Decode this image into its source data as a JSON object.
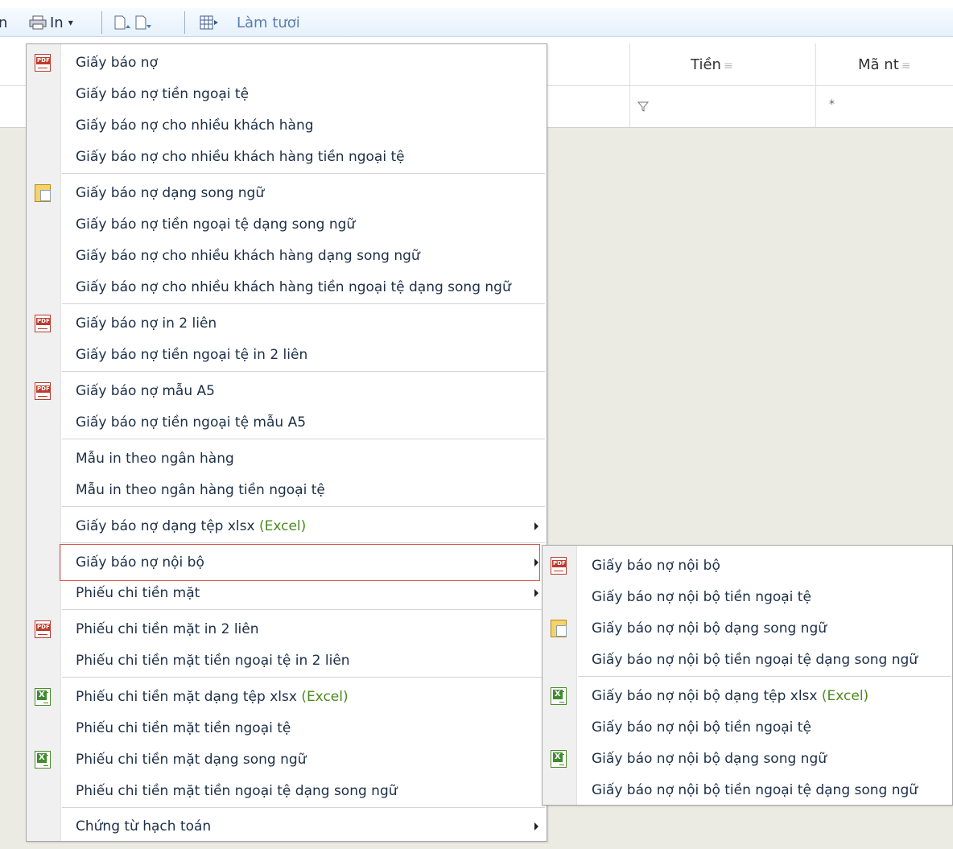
{
  "toolbar": {
    "print_label": "In",
    "refresh_label": "Làm tươi"
  },
  "grid": {
    "columns": [
      "Tiền",
      "Mã nt"
    ],
    "filter_star": "*"
  },
  "menu": {
    "items": [
      {
        "label": "Giấy báo nợ",
        "icon": "pdf"
      },
      {
        "label": "Giấy báo nợ tiền ngoại tệ"
      },
      {
        "label": "Giấy báo nợ cho nhiều khách hàng"
      },
      {
        "label": "Giấy báo nợ cho nhiều khách hàng tiền ngoại tệ"
      },
      {
        "label": "Giấy báo nợ dạng song ngữ",
        "icon": "bilingual"
      },
      {
        "label": "Giấy báo nợ tiền ngoại tệ dạng song ngữ"
      },
      {
        "label": "Giấy báo nợ cho nhiều khách hàng dạng song ngữ"
      },
      {
        "label": "Giấy báo nợ cho nhiều khách hàng tiền ngoại tệ dạng song ngữ"
      },
      {
        "label": "Giấy báo nợ in 2 liên",
        "icon": "pdf"
      },
      {
        "label": "Giấy báo nợ tiền ngoại tệ in 2 liên"
      },
      {
        "label": "Giấy báo nợ mẫu A5",
        "icon": "pdf"
      },
      {
        "label": "Giấy báo nợ tiền ngoại tệ mẫu A5"
      },
      {
        "label": "Mẫu in theo ngân hàng"
      },
      {
        "label": "Mẫu in theo ngân hàng tiền ngoại tệ"
      },
      {
        "label": "Giấy báo nợ dạng tệp xlsx ",
        "suffix": "(Excel)"
      },
      {
        "label": "Giấy báo nợ nội bộ"
      },
      {
        "label": "Phiếu chi tiền mặt"
      },
      {
        "label": "Phiếu chi tiền mặt in 2 liên",
        "icon": "pdf"
      },
      {
        "label": "Phiếu chi tiền mặt tiền ngoại tệ in 2 liên"
      },
      {
        "label": "Phiếu chi tiền mặt dạng tệp xlsx ",
        "suffix": "(Excel)",
        "icon": "excel"
      },
      {
        "label": "Phiếu chi tiền mặt tiền ngoại tệ"
      },
      {
        "label": "Phiếu chi tiền mặt dạng song ngữ",
        "icon": "excel-bilingual"
      },
      {
        "label": "Phiếu chi tiền mặt tiền ngoại tệ dạng song ngữ"
      },
      {
        "label": "Chứng từ hạch toán"
      }
    ]
  },
  "submenu": {
    "items": [
      {
        "label": "Giấy báo nợ nội bộ",
        "icon": "pdf"
      },
      {
        "label": "Giấy báo nợ nội bộ tiền ngoại tệ"
      },
      {
        "label": "Giấy báo nợ nội bộ dạng song ngữ",
        "icon": "bilingual"
      },
      {
        "label": "Giấy báo nợ nội bộ tiền ngoại tệ dạng song ngữ"
      },
      {
        "label": "Giấy báo nợ nội bộ dạng tệp xlsx ",
        "suffix": "(Excel)",
        "icon": "excel"
      },
      {
        "label": "Giấy báo nợ nội bộ tiền ngoại tệ"
      },
      {
        "label": "Giấy báo nợ nội bộ dạng song ngữ",
        "icon": "excel-bilingual"
      },
      {
        "label": "Giấy báo nợ nội bộ tiền ngoại tệ dạng song ngữ"
      }
    ]
  }
}
